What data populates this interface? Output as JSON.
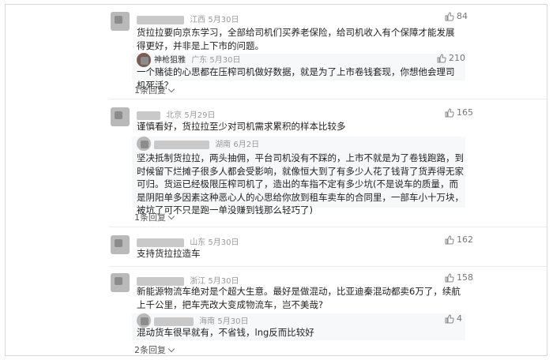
{
  "comments": [
    {
      "location": "江西",
      "date": "5月30日",
      "text": "货拉拉要向京东学习，全部给司机们买养老保险，给司机收入有个保障才能发展得更好，并非是上下市的问题。",
      "likes": "84",
      "reply": {
        "name": "神枪狙雅",
        "location": "广东",
        "date": "5月30日",
        "text": "一个赌徒的心思都在压榨司机做好数据，就是为了上市卷钱套现，你想他会理司机死活？",
        "likes": "210"
      },
      "reply_count": "1条回复"
    },
    {
      "location": "北京",
      "date": "5月29日",
      "text": "谨慎看好，货拉拉至少对司机需求累积的样本比较多",
      "likes": "165",
      "reply": {
        "location": "湖南",
        "date": "6月2日",
        "text": "坚决抵制货拉拉，两头抽佣，平台司机没有不踩的，上市不就是为了卷钱跑路，到时候留下烂摊子很多人都会受影响，就像恒大到了有多少人花了钱背了货弄得无家可归。货运已经极限压榨司机了，造出的车指不定有多少坑(不是说车的质量，而是阴阳单多因素这种恶心人的心思给你放到租车卖车的合同里，一部车小十万块，被坑了可不只是跑一单没赚到钱那么轻巧了)"
      },
      "reply_count": "1条回复"
    },
    {
      "location": "山东",
      "date": "5月30日",
      "text": "支持货拉拉造车",
      "likes": "162"
    },
    {
      "location": "浙江",
      "date": "5月30日",
      "text": "新能源物流车绝对是个超大生意。最好是做混动，比亚迪秦混动都卖6万了，续航上千公里，把车壳改大变成物流车，岂不美哉?",
      "likes": "158",
      "reply": {
        "location": "海南",
        "date": "5月30日",
        "text": "混动货车很早就有，不省钱，lng反而比较好",
        "likes": "4"
      },
      "reply_count": "2条回复"
    }
  ],
  "icons": {
    "like": "thumbs-up-icon",
    "expand": "chevron-down-icon"
  },
  "colors": {
    "text": "#222222",
    "meta": "#999999",
    "reply_bg": "#f7f8fa"
  }
}
